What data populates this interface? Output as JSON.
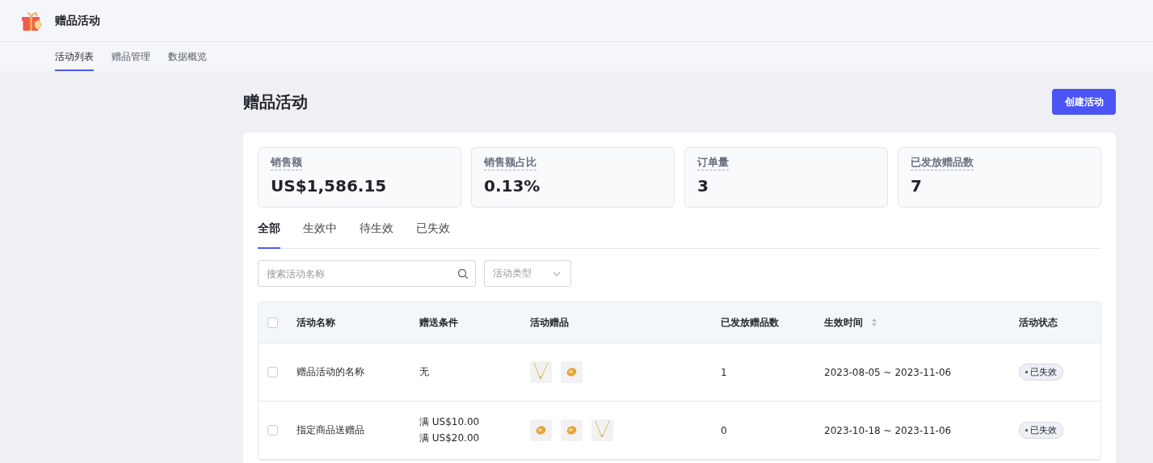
{
  "app": {
    "title": "赠品活动"
  },
  "nav_tabs": [
    {
      "label": "活动列表",
      "selected": true
    },
    {
      "label": "赠品管理",
      "selected": false
    },
    {
      "label": "数据概览",
      "selected": false
    }
  ],
  "page": {
    "title": "赠品活动",
    "primary_button": "创建活动"
  },
  "stats": [
    {
      "label": "销售额",
      "value": "US$1,586.15"
    },
    {
      "label": "销售额占比",
      "value": "0.13%"
    },
    {
      "label": "订单量",
      "value": "3"
    },
    {
      "label": "已发放赠品数",
      "value": "7"
    }
  ],
  "status_tabs": [
    {
      "label": "全部",
      "selected": true
    },
    {
      "label": "生效中",
      "selected": false
    },
    {
      "label": "待生效",
      "selected": false
    },
    {
      "label": "已失效",
      "selected": false
    }
  ],
  "search": {
    "placeholder": "搜索活动名称"
  },
  "type_filter": {
    "placeholder": "活动类型"
  },
  "table": {
    "select_all_checked": false,
    "columns": [
      {
        "label": "活动名称",
        "sortable": false
      },
      {
        "label": "赠送条件",
        "sortable": false
      },
      {
        "label": "活动赠品",
        "sortable": false
      },
      {
        "label": "已发放赠品数",
        "sortable": false
      },
      {
        "label": "生效时间",
        "sortable": true
      },
      {
        "label": "活动状态",
        "sortable": false
      }
    ],
    "rows": [
      {
        "checked": false,
        "name": "赠品活动的名称",
        "conditions": [
          "无"
        ],
        "gifts": [
          {
            "kind": "necklace"
          },
          {
            "kind": "ring"
          }
        ],
        "issued": "1",
        "period": "2023-08-05 ~ 2023-11-06",
        "status": "已失效"
      },
      {
        "checked": false,
        "name": "指定商品送赠品",
        "conditions": [
          "满 US$10.00",
          "满 US$20.00"
        ],
        "gifts": [
          {
            "kind": "ring"
          },
          {
            "kind": "ring"
          },
          {
            "kind": "necklace"
          }
        ],
        "issued": "0",
        "period": "2023-10-18 ~ 2023-11-06",
        "status": "已失效"
      }
    ]
  }
}
